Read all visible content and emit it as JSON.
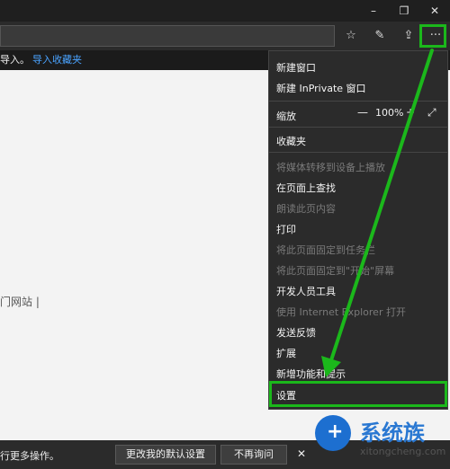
{
  "window": {
    "minimize_glyph": "–",
    "restore_glyph": "❐",
    "close_glyph": "✕"
  },
  "toolbar": {
    "favorite_glyph": "☆",
    "pen_glyph": "✎",
    "share_glyph": "⇪",
    "more_glyph": "···"
  },
  "favorites_bar": {
    "text": "导入。",
    "link": "导入收藏夹"
  },
  "content": {
    "site_label": "门网站 |"
  },
  "bottom_bar": {
    "message": "行更多操作。",
    "primary_button": "更改我的默认设置",
    "secondary_button": "不再询问",
    "close_glyph": "✕"
  },
  "menu": {
    "new_window": "新建窗口",
    "new_inprivate": "新建 InPrivate 窗口",
    "zoom_label": "缩放",
    "zoom_minus": "—",
    "zoom_value": "100%",
    "zoom_plus": "+",
    "fullscreen_glyph": "⤢",
    "favorites": "收藏夹",
    "cast_media": "将媒体转移到设备上播放",
    "find_on_page": "在页面上查找",
    "read_aloud": "朗读此页内容",
    "print": "打印",
    "pin_taskbar": "将此页面固定到任务栏",
    "pin_start": "将此页面固定到\"开始\"屏幕",
    "dev_tools": "开发人员工具",
    "open_ie": "使用 Internet Explorer 打开",
    "feedback": "发送反馈",
    "extensions": "扩展",
    "whats_new": "新增功能和提示",
    "settings": "设置"
  },
  "watermark": {
    "logo_text": "系统族",
    "url": "xitongcheng.com"
  },
  "colors": {
    "highlight": "#1bb81b",
    "menu_bg": "#2b2b2b",
    "link": "#4aa3ff"
  }
}
